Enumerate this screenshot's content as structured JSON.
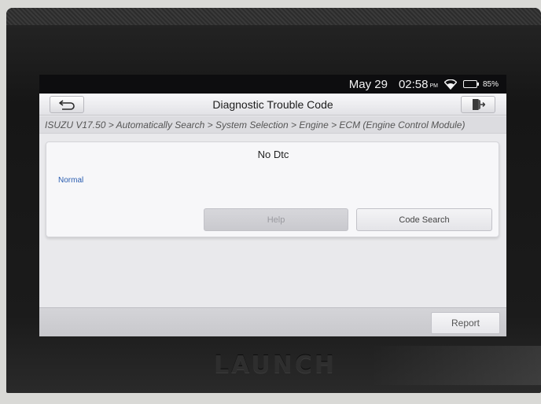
{
  "status_bar": {
    "date": "May 29",
    "time": "02:58",
    "ampm": "PM",
    "battery_percent": "85%",
    "battery_level": 0.85,
    "wifi_icon": "wifi-icon",
    "battery_color": "#40c040"
  },
  "header": {
    "title": "Diagnostic Trouble Code",
    "back_icon": "back-arrow-icon",
    "exit_icon": "exit-icon"
  },
  "breadcrumb": "ISUZU V17.50 > Automatically Search > System Selection > Engine > ECM (Engine Control Module)",
  "result": {
    "message": "No Dtc",
    "status": "Normal",
    "status_color": "#2a5db0"
  },
  "buttons": {
    "help": "Help",
    "code_search": "Code Search",
    "report": "Report"
  },
  "device": {
    "brand": "LAUNCH"
  }
}
